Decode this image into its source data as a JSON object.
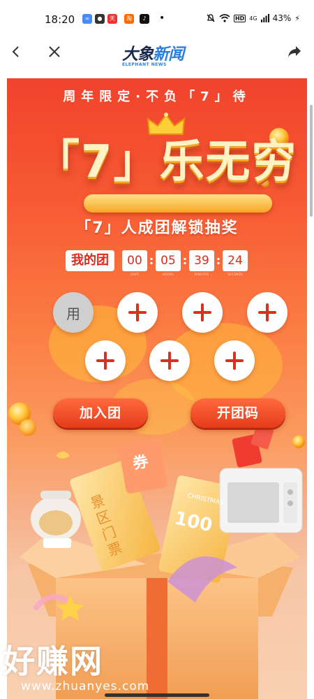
{
  "status_bar": {
    "time": "18:20",
    "network": "4G",
    "battery": "43%"
  },
  "nav": {
    "logo_main_1": "大象",
    "logo_main_2": "新闻",
    "logo_sub": "ELEPHANT NEWS"
  },
  "banner": {
    "tagline": "周年限定·不负「7」待",
    "title": "「7」乐无穷",
    "subtitle": "「7」人成团解锁抽奖",
    "my_team": "我的团",
    "countdown": [
      {
        "value": "00",
        "label": "DAYS"
      },
      {
        "value": "05",
        "label": "HOURS"
      },
      {
        "value": "39",
        "label": "MINUTES"
      },
      {
        "value": "24",
        "label": "SECONDS"
      }
    ],
    "member_avatar": "用",
    "join_button": "加入团",
    "code_button": "开团码",
    "ticket_text": "景区门票",
    "voucher_text": "券",
    "coupon_title": "CHRISTMAS",
    "coupon_value": "100"
  },
  "watermark": {
    "main": "好赚网",
    "sub": "www.zhuanyes.com"
  },
  "colors": {
    "accent_red": "#e0291b",
    "banner_top": "#f0432c",
    "button": "#ff6a3d"
  }
}
